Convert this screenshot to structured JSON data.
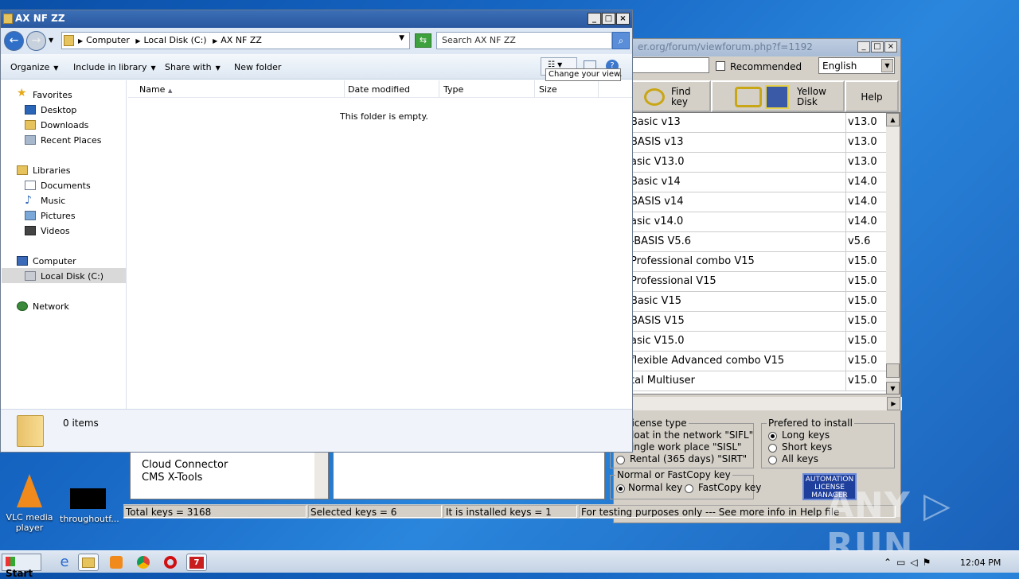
{
  "bg_app": {
    "title_url": "er.org/forum/viewforum.php?f=1192",
    "recommended_label": "Recommended",
    "language": "English",
    "buttons": {
      "find_key": "Find key",
      "yellow_disk": "Yellow Disk",
      "help": "Help"
    },
    "keys": [
      {
        "name": "Basic v13",
        "version": "v13.0"
      },
      {
        "name": "BASIS v13",
        "version": "v13.0"
      },
      {
        "name": "asic V13.0",
        "version": "v13.0"
      },
      {
        "name": "Basic v14",
        "version": "v14.0"
      },
      {
        "name": "BASIS v14",
        "version": "v14.0"
      },
      {
        "name": "asic v14.0",
        "version": "v14.0"
      },
      {
        "name": "-BASIS V5.6",
        "version": "v5.6"
      },
      {
        "name": "Professional combo V15",
        "version": "v15.0"
      },
      {
        "name": "Professional V15",
        "version": "v15.0"
      },
      {
        "name": "Basic V15",
        "version": "v15.0"
      },
      {
        "name": "BASIS V15",
        "version": "v15.0"
      },
      {
        "name": "asic V15.0",
        "version": "v15.0"
      },
      {
        "name": "flexible Advanced combo V15",
        "version": "v15.0"
      },
      {
        "name": "tal Multiuser",
        "version": "v15.0"
      }
    ],
    "license_group_title": "ct license type",
    "license_options": [
      "loat in the network \"SIFL\"",
      "ingle work place \"SISL\"",
      "Rental (365 days) \"SIRT\""
    ],
    "install_group_title": "Prefered to install",
    "install_options": [
      "Long keys",
      "Short keys",
      "All keys"
    ],
    "copy_group_title": "Normal or FastCopy key",
    "copy_options": [
      "Normal key",
      "FastCopy key"
    ],
    "auto_license": "AUTOMATION LICENSE MANAGER",
    "tree_items": [
      "Cloud Connector",
      "CMS X-Tools"
    ],
    "status": {
      "total": "Total keys = 3168",
      "selected": "Selected keys = 6",
      "installed": "It is installed keys = 1",
      "testing": "For testing purposes only --- See more info in Help file"
    }
  },
  "explorer": {
    "title": "AX NF ZZ",
    "breadcrumb": [
      "Computer",
      "Local Disk (C:)",
      "AX NF ZZ"
    ],
    "search_placeholder": "Search AX NF ZZ",
    "commands": {
      "organize": "Organize",
      "include": "Include in library",
      "share": "Share with",
      "new_folder": "New folder"
    },
    "tooltip": "Change your view.",
    "nav": {
      "favorites": "Favorites",
      "desktop": "Desktop",
      "downloads": "Downloads",
      "recent": "Recent Places",
      "libraries": "Libraries",
      "documents": "Documents",
      "music": "Music",
      "pictures": "Pictures",
      "videos": "Videos",
      "computer": "Computer",
      "local_disk": "Local Disk (C:)",
      "network": "Network"
    },
    "columns": {
      "name": "Name",
      "date": "Date modified",
      "type": "Type",
      "size": "Size"
    },
    "empty_message": "This folder is empty.",
    "item_count": "0 items"
  },
  "desktop": {
    "vlc_label": "VLC media player",
    "thr_label": "throughoutf..."
  },
  "taskbar": {
    "start": "Start",
    "clock": "12:04 PM"
  },
  "watermark": "ANY ▷ RUN"
}
